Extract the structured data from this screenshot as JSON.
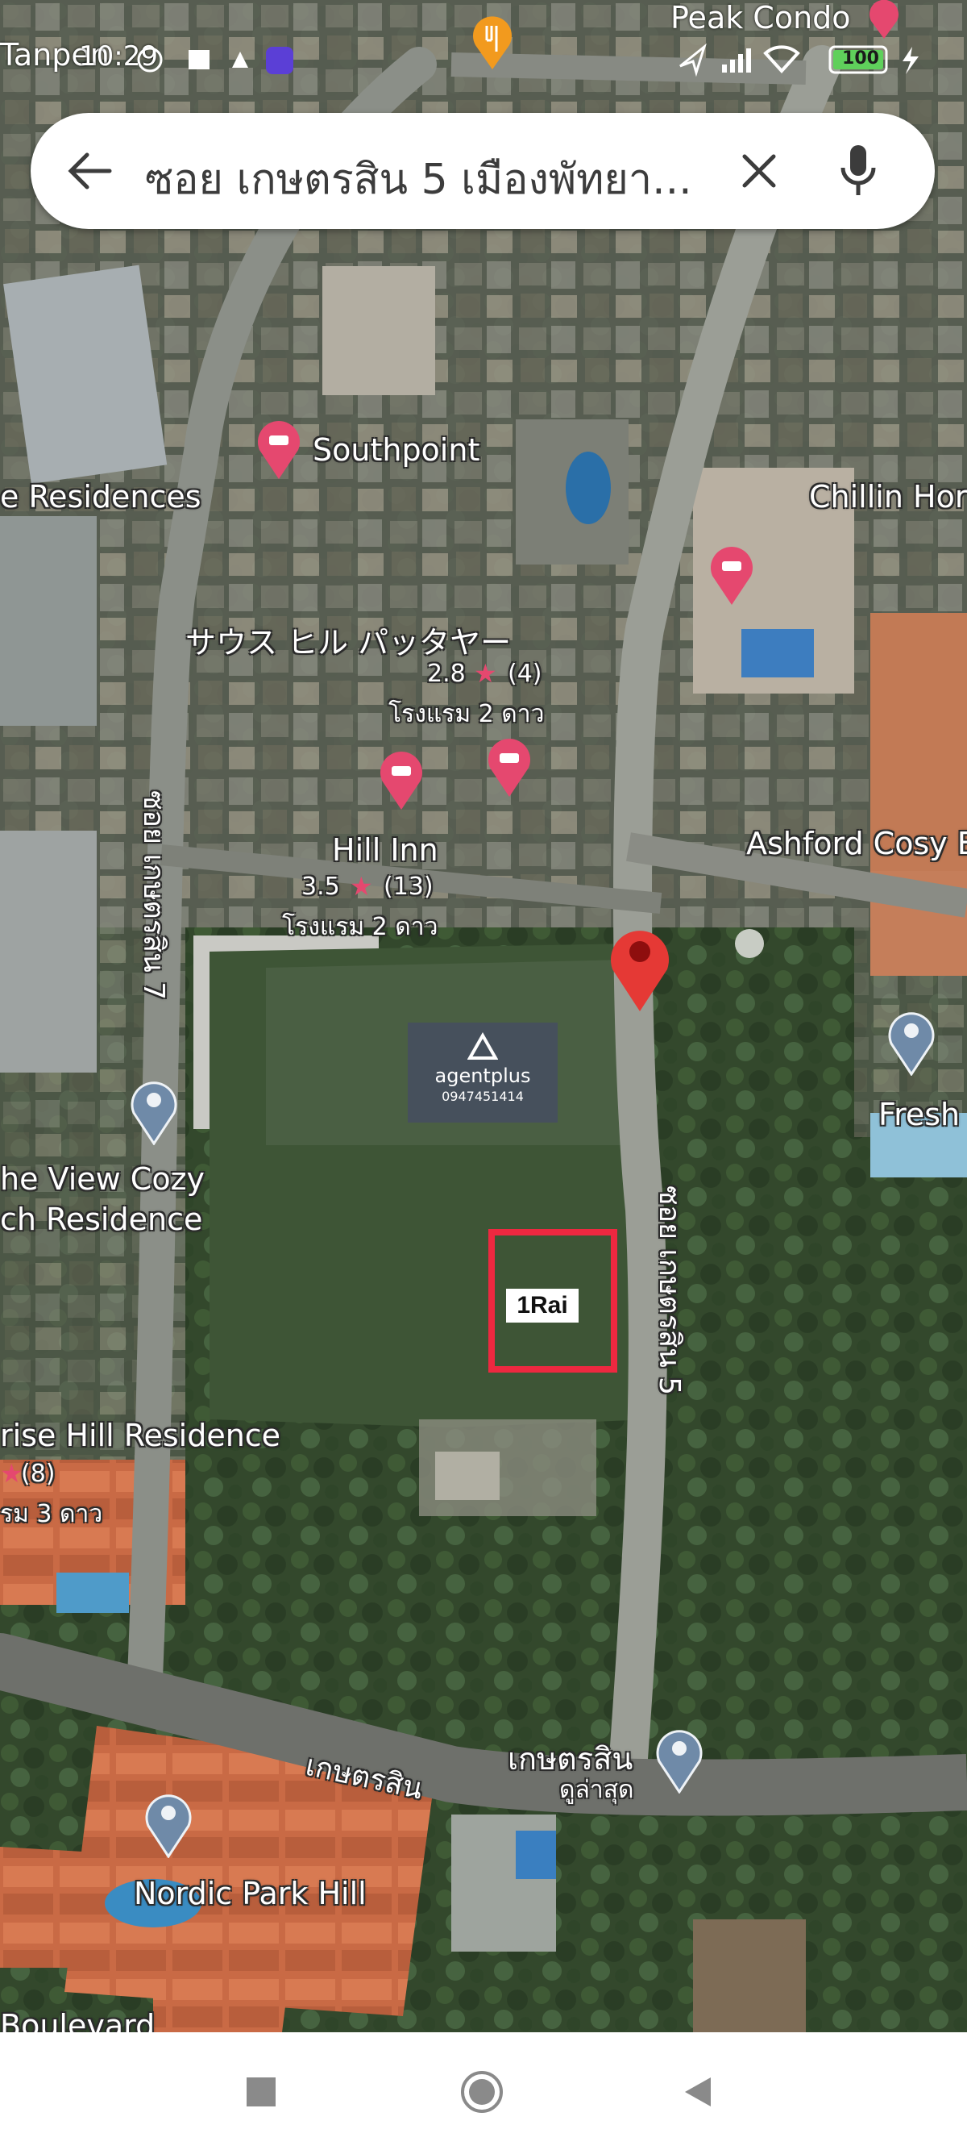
{
  "status_bar": {
    "left_text": "Tanpen",
    "time": "10:29",
    "top_label": "Peak Condo",
    "battery": "100"
  },
  "search": {
    "query": "ซอย เกษตรสิน 5 เมืองพัทยา..."
  },
  "map": {
    "type": "satellite",
    "places": [
      {
        "name": "Southpoint",
        "category": "hotel"
      },
      {
        "name": "e Residences",
        "category": "place"
      },
      {
        "name": "Chillin Hor",
        "category": "place"
      },
      {
        "name": "サウス ヒル パッタヤー",
        "rating": "2.8",
        "reviews": "(4)",
        "type": "โรงแรม 2 ดาว",
        "category": "hotel"
      },
      {
        "name": "Hill Inn",
        "rating": "3.5",
        "reviews": "(13)",
        "type": "โรงแรม 2 ดาว",
        "category": "hotel"
      },
      {
        "name": "Ashford Cosy E",
        "category": "place"
      },
      {
        "name": "Fresh",
        "category": "place"
      },
      {
        "name": "he View Cozy",
        "name2": "ch Residence",
        "category": "place"
      },
      {
        "name": "rise Hill Residence",
        "reviews": "(8)",
        "type": "รม 3 ดาว",
        "category": "hotel"
      },
      {
        "name": "Nordic Park Hill",
        "category": "place"
      },
      {
        "name": "Boulevard",
        "category": "place"
      },
      {
        "name": "เกษตรสิน",
        "subtitle": "ดูล่าสุด",
        "category": "place"
      }
    ],
    "roads": [
      {
        "name": "ซอย เกษตรสิน 7"
      },
      {
        "name": "ซอย เกษตรสิน 5"
      },
      {
        "name": "เกษตรสิน"
      }
    ],
    "selected_pin_color": "#e53935"
  },
  "overlay": {
    "watermark_brand": "agentplus",
    "watermark_phone": "0947451414",
    "plot_label": "1Rai",
    "plot_color": "#ee2840"
  },
  "nav": {
    "buttons": [
      {
        "icon": "recents-square-icon"
      },
      {
        "icon": "home-circle-icon"
      },
      {
        "icon": "back-triangle-icon"
      }
    ]
  }
}
